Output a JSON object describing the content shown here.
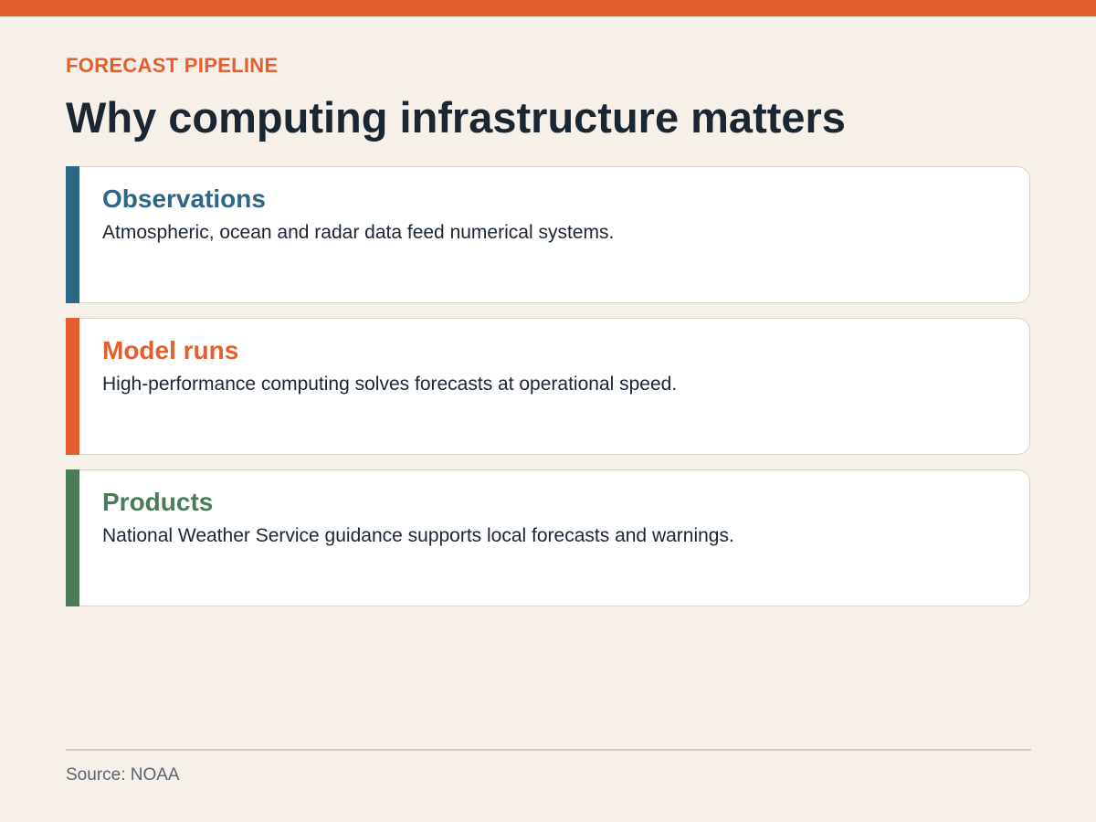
{
  "colors": {
    "accent": "#e55e2d",
    "observations": "#2d6786",
    "model_runs": "#e55e2d",
    "products": "#4c7b5a",
    "background": "#f6f0e9",
    "title": "#1b2633"
  },
  "header": {
    "eyebrow": "FORECAST PIPELINE",
    "title": "Why computing infrastructure matters"
  },
  "steps": [
    {
      "title": "Observations",
      "text": "Atmospheric, ocean and radar data feed numerical systems.",
      "color": "#2d6786"
    },
    {
      "title": "Model runs",
      "text": "High-performance computing solves forecasts at operational speed.",
      "color": "#e55e2d"
    },
    {
      "title": "Products",
      "text": "National Weather Service guidance supports local forecasts and warnings.",
      "color": "#4c7b5a"
    }
  ],
  "footer": {
    "source": "Source: NOAA"
  }
}
